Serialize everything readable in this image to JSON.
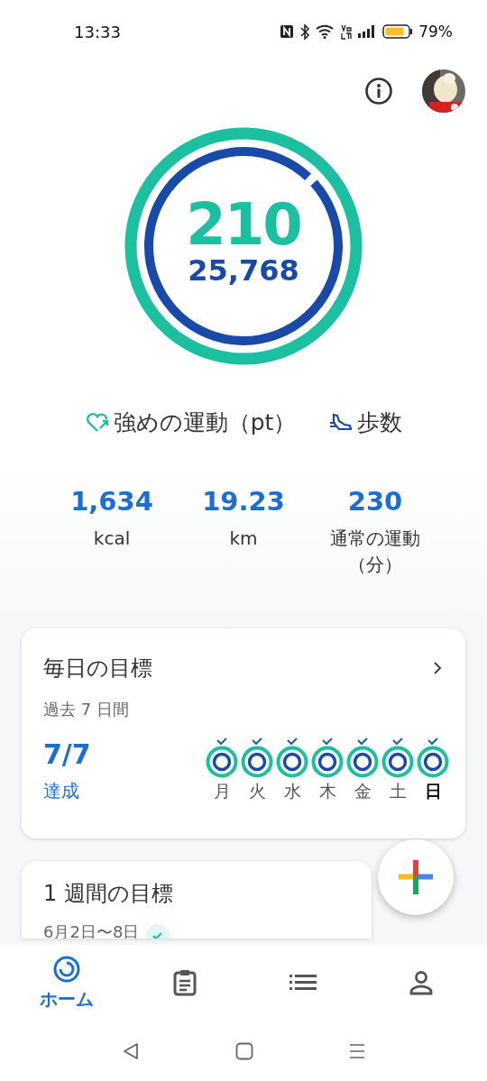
{
  "status_bar": {
    "time": "13:33",
    "battery": "79%"
  },
  "rings": {
    "points_ring": {
      "level": 1
    },
    "steps_ring": {
      "level": 1
    },
    "points": "210",
    "steps": "25,768"
  },
  "legend": [
    {
      "kind": "heart",
      "label": "強めの運動（pt）"
    },
    {
      "kind": "steps",
      "label": "歩数"
    }
  ],
  "stats": [
    {
      "value": "1,634",
      "label": "kcal"
    },
    {
      "value": "19.23",
      "label": "km"
    },
    {
      "value": "230",
      "label": "通常の運動（分）"
    }
  ],
  "daily_goal": {
    "title": "毎日の目標",
    "subtitle": "過去 7 日間",
    "count": "7/7",
    "count_label": "達成",
    "days": [
      {
        "label": "月",
        "done": true,
        "selected": false
      },
      {
        "label": "火",
        "done": true,
        "selected": false
      },
      {
        "label": "水",
        "done": true,
        "selected": false
      },
      {
        "label": "木",
        "done": true,
        "selected": false
      },
      {
        "label": "金",
        "done": true,
        "selected": false
      },
      {
        "label": "土",
        "done": true,
        "selected": false
      },
      {
        "label": "日",
        "done": true,
        "selected": true
      }
    ]
  },
  "weekly_goal": {
    "title": "1 週間の目標",
    "dates": "6月2日〜8日",
    "done": true
  },
  "bottom_nav": [
    {
      "kind": "home",
      "label": "ホーム",
      "selected": true
    },
    {
      "kind": "journal",
      "selected": false
    },
    {
      "kind": "browse",
      "selected": false
    },
    {
      "kind": "profile",
      "selected": false
    }
  ]
}
